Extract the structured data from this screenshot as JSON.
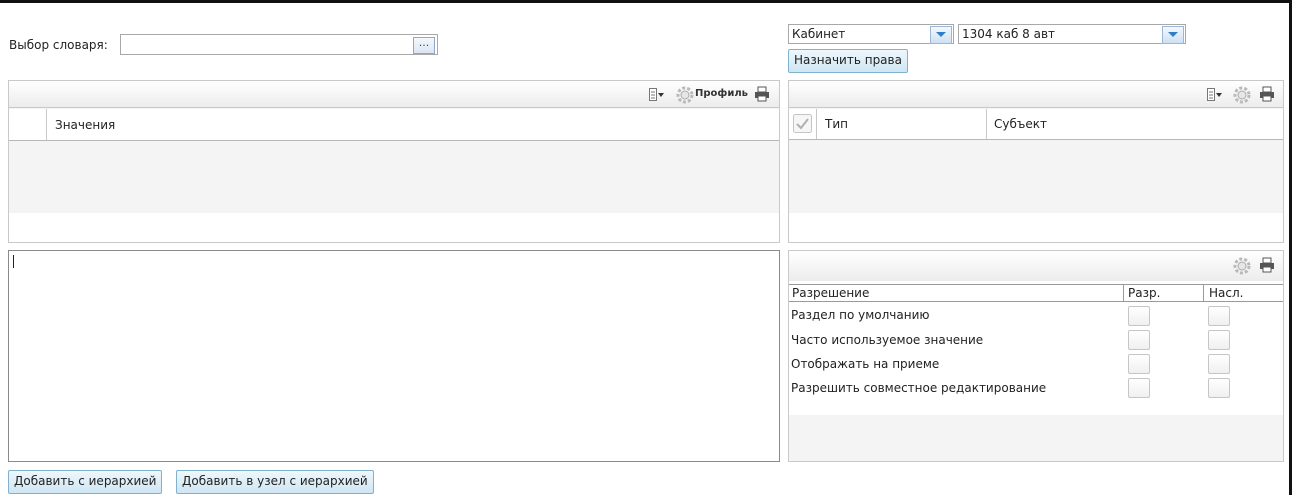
{
  "dictionary": {
    "label": "Выбор словаря:",
    "value": "",
    "browse_label": "..."
  },
  "selectors": {
    "type_value": "Кабинет",
    "object_value": "1304 каб 8 авт",
    "assign_button": "Назначить права"
  },
  "values_panel": {
    "toolbar": {
      "profile_label": "Профиль",
      "icons": [
        "columns-menu-icon",
        "gear-icon",
        "print-icon"
      ]
    },
    "columns": [
      "Значения"
    ]
  },
  "subjects_panel": {
    "toolbar": {
      "icons": [
        "columns-menu-icon",
        "gear-icon",
        "print-icon"
      ]
    },
    "columns": [
      "Тип",
      "Субъект"
    ]
  },
  "permissions_panel": {
    "toolbar": {
      "icons": [
        "gear-icon",
        "print-icon"
      ]
    },
    "columns": [
      "Разрешение",
      "Разр.",
      "Насл."
    ],
    "rows": [
      {
        "name": "Раздел по умолчанию",
        "allow": false,
        "inherit": false
      },
      {
        "name": "Часто используемое значение",
        "allow": false,
        "inherit": false
      },
      {
        "name": "Отображать на приеме",
        "allow": false,
        "inherit": false
      },
      {
        "name": "Разрешить совместное редактирование",
        "allow": false,
        "inherit": false
      }
    ]
  },
  "bottom_buttons": {
    "add_hierarchy": "Добавить с иерархией",
    "add_to_node_hierarchy": "Добавить в узел с иерархией"
  }
}
